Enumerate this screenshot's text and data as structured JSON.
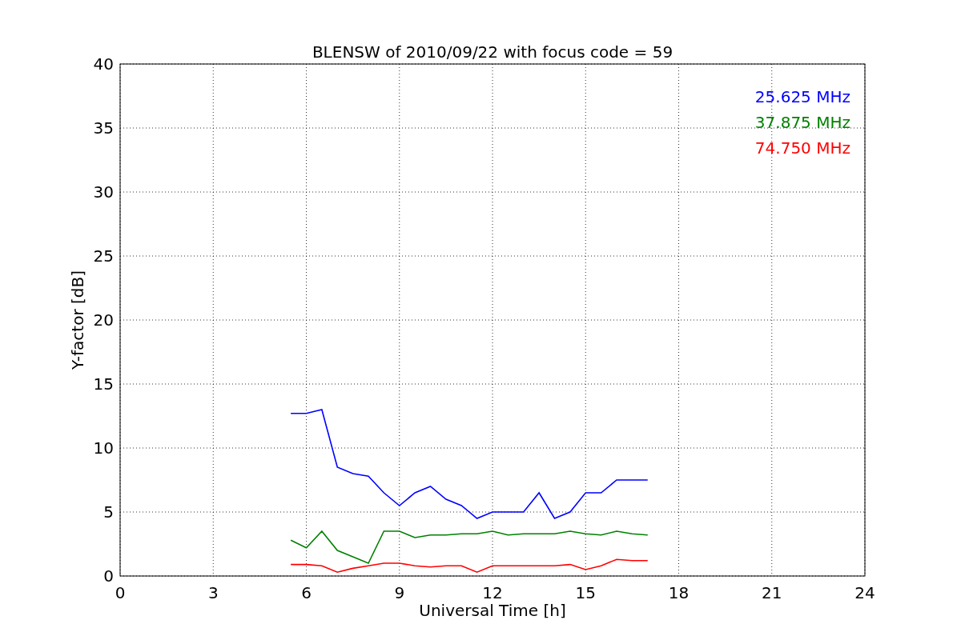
{
  "chart_data": {
    "type": "line",
    "title": "BLENSW of 2010/09/22 with focus code = 59",
    "xlabel": "Universal Time [h]",
    "ylabel": "Y-factor [dB]",
    "x": [
      5.5,
      6,
      6.5,
      7,
      7.5,
      8,
      8.5,
      9,
      9.5,
      10,
      10.5,
      11,
      11.5,
      12,
      12.5,
      13,
      13.5,
      14,
      14.5,
      15,
      15.5,
      16,
      16.5,
      17
    ],
    "series": [
      {
        "name": "25.625 MHz",
        "color": "#0000ff",
        "values": [
          12.7,
          12.7,
          13.0,
          8.5,
          8.0,
          7.8,
          6.5,
          5.5,
          6.5,
          7.0,
          6.0,
          5.5,
          4.5,
          5.0,
          5.0,
          5.0,
          6.5,
          4.5,
          5.0,
          6.5,
          6.5,
          7.5,
          7.5,
          7.5
        ]
      },
      {
        "name": "37.875 MHz",
        "color": "#008000",
        "values": [
          2.8,
          2.2,
          3.5,
          2.0,
          1.5,
          1.0,
          3.5,
          3.5,
          3.0,
          3.2,
          3.2,
          3.3,
          3.3,
          3.5,
          3.2,
          3.3,
          3.3,
          3.3,
          3.5,
          3.3,
          3.2,
          3.5,
          3.3,
          3.2
        ]
      },
      {
        "name": "74.750 MHz",
        "color": "#ff0000",
        "values": [
          0.9,
          0.9,
          0.8,
          0.3,
          0.6,
          0.8,
          1.0,
          1.0,
          0.8,
          0.7,
          0.8,
          0.8,
          0.3,
          0.8,
          0.8,
          0.8,
          0.8,
          0.8,
          0.9,
          0.5,
          0.8,
          1.3,
          1.2,
          1.2
        ]
      }
    ],
    "grid": true,
    "xlim": [
      0,
      24
    ],
    "ylim": [
      0,
      40
    ],
    "xticks": [
      0,
      3,
      6,
      9,
      12,
      15,
      18,
      21,
      24
    ],
    "yticks": [
      0,
      5,
      10,
      15,
      20,
      25,
      30,
      35,
      40
    ]
  }
}
